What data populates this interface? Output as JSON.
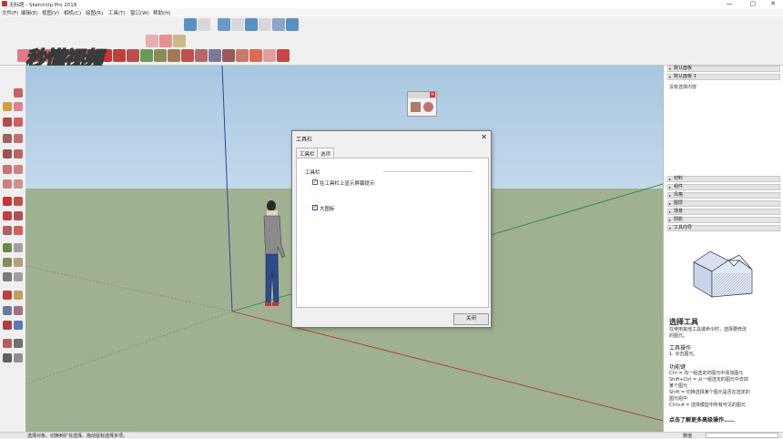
{
  "window": {
    "title": "无标题 - SketchUp Pro 2018",
    "minimize": "—",
    "maximize": "▢",
    "close": "✕"
  },
  "menu": [
    "文件(F)",
    "编辑(E)",
    "视图(V)",
    "相机(C)",
    "绘图(R)",
    "工具(T)",
    "窗口(W)",
    "帮助(H)"
  ],
  "watermark": "秒懂视频",
  "dialog": {
    "title": "工具栏",
    "close": "✕",
    "tabs": [
      "工具栏",
      "选项"
    ],
    "section": "工具栏",
    "option1": "在工具栏上显示屏幕提示",
    "option2": "大图标",
    "close_button": "关闭"
  },
  "right_panel": {
    "trays_top": [
      "默认面板",
      "默认面板 1"
    ],
    "tray_top_content": "没有选择内容",
    "trays": [
      "材料",
      "组件",
      "风格",
      "图层",
      "场景",
      "阴影",
      "工具向导"
    ],
    "instructor": {
      "title": "选择工具",
      "desc": [
        "在使用其他工具或命令时，选择要修改",
        "的图元。"
      ],
      "ops_title": "工具操作",
      "ops": [
        "1. 点击图元。"
      ],
      "keys_title": "功能键",
      "keys": [
        "Ctrl = 向一组选定的图元中添加图元",
        "Shift+Ctrl = 从一组选定的图元中去掉",
        "某个图元",
        "Shift = 切换选择某个图元是否在选定的",
        "图元组中",
        "Ctrl+A = 选择模型中所有可见的图元"
      ],
      "more": "点击了解更多高级操作……"
    }
  },
  "status": {
    "text": "选择对象。切换到扩充选择。拖动鼠标选择多项。",
    "measure": "数值"
  }
}
